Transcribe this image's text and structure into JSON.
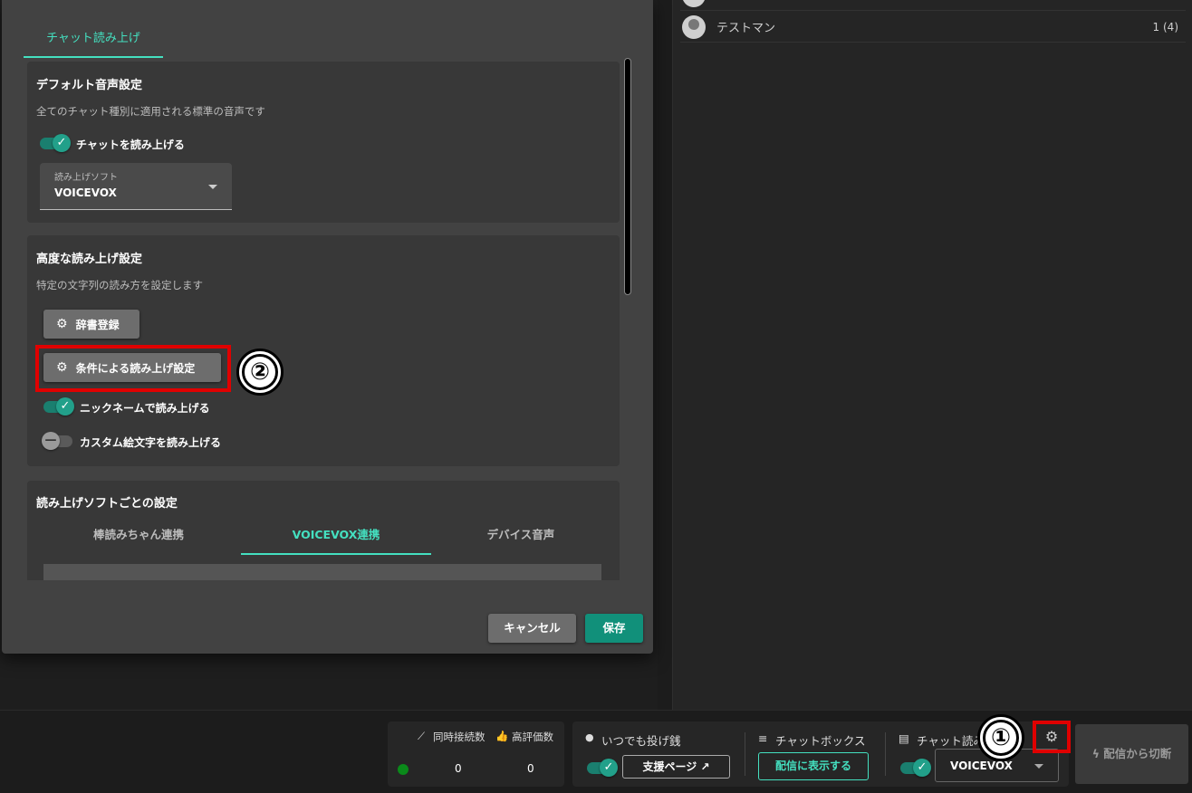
{
  "dialog": {
    "tab_label": "チャット読み上げ",
    "default_section": {
      "title": "デフォルト音声設定",
      "description": "全てのチャット種別に適用される標準の音声です",
      "toggle_label": "チャットを読み上げる",
      "toggle_on": true,
      "select_label": "読み上げソフト",
      "select_value": "VOICEVOX"
    },
    "advanced_section": {
      "title": "高度な読み上げ設定",
      "description": "特定の文字列の読み方を設定します",
      "dictionary_button": "辞書登録",
      "conditional_button": "条件による読み上げ設定",
      "nickname_toggle_label": "ニックネームで読み上げる",
      "custom_emoji_toggle_label": "カスタム絵文字を読み上げる"
    },
    "per_software_section": {
      "title": "読み上げソフトごとの設定",
      "tabs": [
        "棒読みちゃん連携",
        "VOICEVOX連携",
        "デバイス音声"
      ],
      "active_tab": "VOICEVOX連携"
    },
    "cancel_label": "キャンセル",
    "save_label": "保存"
  },
  "markers": {
    "one": "①",
    "two": "②"
  },
  "viewer_list": {
    "rows": [
      {
        "name": "テストマン",
        "count": "1 (4)"
      }
    ]
  },
  "bottom_bar": {
    "stats": {
      "concurrent_label": "同時接続数",
      "likes_label": "高評価数",
      "concurrent_value": "0",
      "likes_value": "0"
    },
    "tip_label": "いつでも投げ銭",
    "support_page_label": "支援ページ",
    "chatbox_label": "チャットボックス",
    "show_on_stream_label": "配信に表示する",
    "chat_read_label": "チャット読み上げ",
    "chat_read_value": "VOICEVOX",
    "disconnect_label": "配信から切断"
  },
  "colors": {
    "accent": "#44e0c0",
    "toggle_on": "#22a08a",
    "highlight": "#e00000",
    "save_button": "#11907a"
  }
}
